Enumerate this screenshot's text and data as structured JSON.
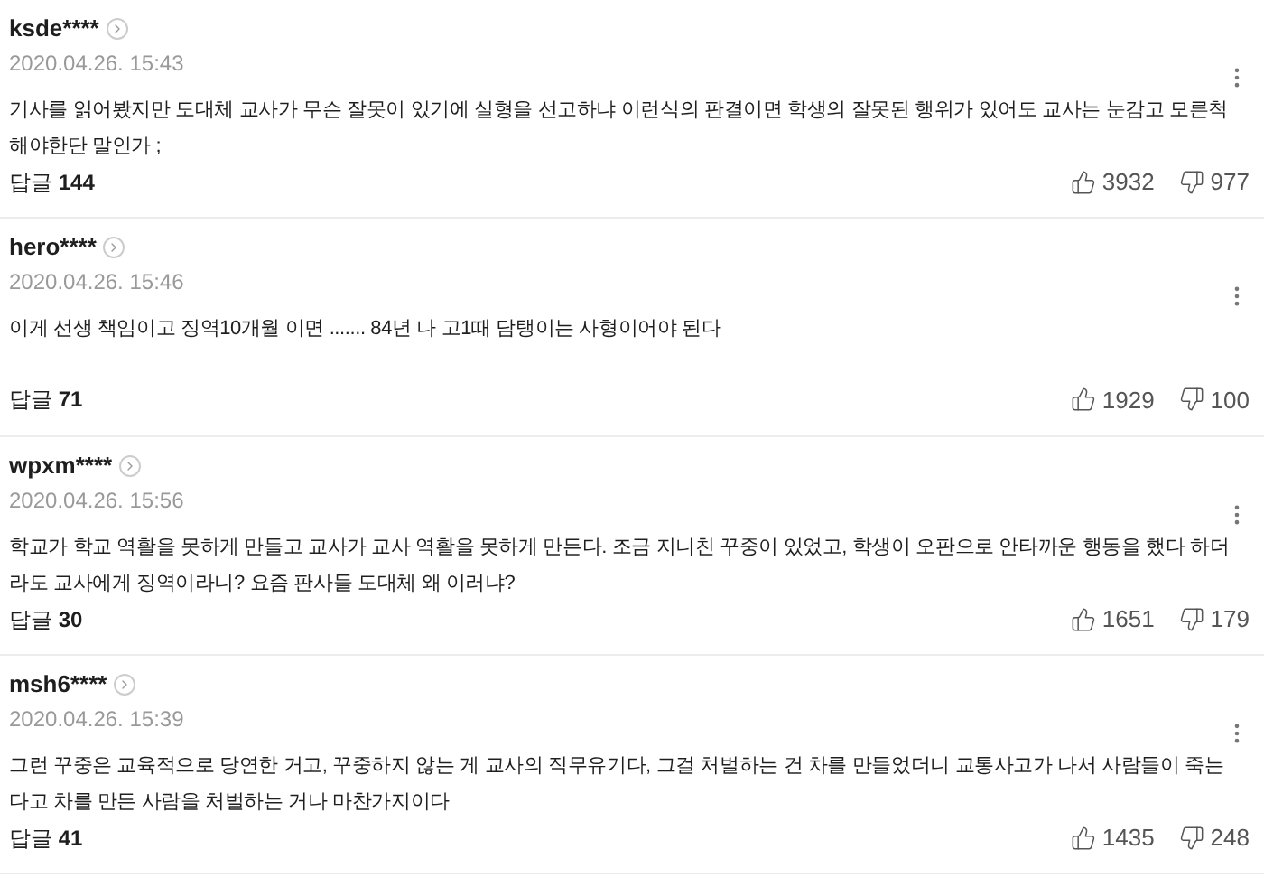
{
  "comments": [
    {
      "author": "ksde****",
      "date": "2020.04.26. 15:43",
      "text": "기사를 읽어봤지만 도대체 교사가 무슨 잘못이 있기에 실형을 선고하냐 이런식의 판결이면 학생의 잘못된 행위가 있어도 교사는 눈감고 모른척 해야한단 말인가 ;",
      "reply_label": "답글",
      "reply_count": "144",
      "likes": "3932",
      "dislikes": "977"
    },
    {
      "author": "hero****",
      "date": "2020.04.26. 15:46",
      "text": "이게 선생 책임이고 징역10개월 이면 ....... 84년 나 고1때 담탱이는 사형이어야 된다",
      "reply_label": "답글",
      "reply_count": "71",
      "likes": "1929",
      "dislikes": "100"
    },
    {
      "author": "wpxm****",
      "date": "2020.04.26. 15:56",
      "text": "학교가 학교 역활을 못하게 만들고 교사가 교사 역활을 못하게 만든다. 조금 지니친 꾸중이 있었고, 학생이 오판으로 안타까운 행동을 했다 하더라도 교사에게 징역이라니? 요즘 판사들 도대체 왜 이러냐?",
      "reply_label": "답글",
      "reply_count": "30",
      "likes": "1651",
      "dislikes": "179"
    },
    {
      "author": "msh6****",
      "date": "2020.04.26. 15:39",
      "text": "그런 꾸중은 교육적으로 당연한 거고, 꾸중하지 않는 게 교사의 직무유기다, 그걸 처벌하는 건 차를 만들었더니 교통사고가 나서 사람들이 죽는다고 차를 만든 사람을 처벌하는 거나 마찬가지이다",
      "reply_label": "답글",
      "reply_count": "41",
      "likes": "1435",
      "dislikes": "248"
    }
  ]
}
